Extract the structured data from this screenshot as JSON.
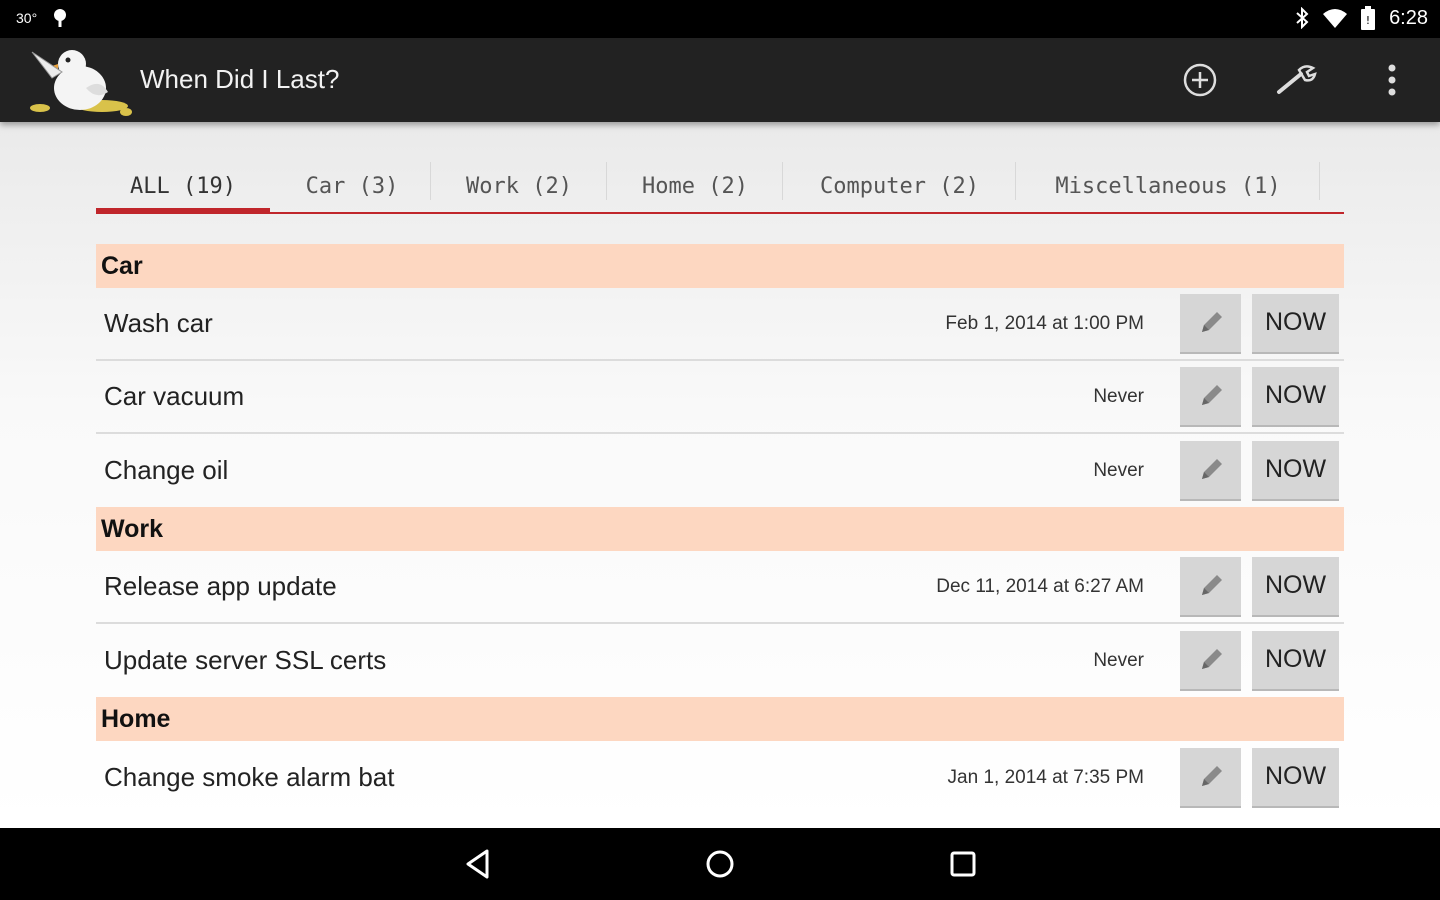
{
  "status_bar": {
    "temperature": "30°",
    "time": "6:28",
    "icons": [
      "notification-icon",
      "bluetooth-icon",
      "wifi-icon",
      "battery-icon"
    ]
  },
  "action_bar": {
    "title": "When Did I Last?",
    "actions": [
      "add-icon",
      "settings-wrench-icon",
      "overflow-menu-icon"
    ]
  },
  "tabs": [
    {
      "label": "ALL (19)",
      "active": true
    },
    {
      "label": "Car (3)",
      "active": false
    },
    {
      "label": "Work (2)",
      "active": false
    },
    {
      "label": "Home (2)",
      "active": false
    },
    {
      "label": "Computer (2)",
      "active": false
    },
    {
      "label": "Miscellaneous (1)",
      "active": false
    }
  ],
  "sections": [
    {
      "title": "Car",
      "items": [
        {
          "name": "Wash car",
          "last": "Feb 1, 2014 at 1:00 PM"
        },
        {
          "name": "Car vacuum",
          "last": "Never"
        },
        {
          "name": "Change oil",
          "last": "Never"
        }
      ]
    },
    {
      "title": "Work",
      "items": [
        {
          "name": "Release app update",
          "last": "Dec 11, 2014 at 6:27 AM"
        },
        {
          "name": "Update server SSL certs",
          "last": "Never"
        }
      ]
    },
    {
      "title": "Home",
      "items": [
        {
          "name": "Change smoke alarm bat",
          "last": "Jan 1, 2014 at 7:35 PM"
        }
      ]
    }
  ],
  "buttons": {
    "now_label": "NOW"
  },
  "colors": {
    "accent": "#c0262b",
    "section_header": "#fdd7c1",
    "action_bar": "#222222",
    "button_bg": "#d6d6d6"
  }
}
